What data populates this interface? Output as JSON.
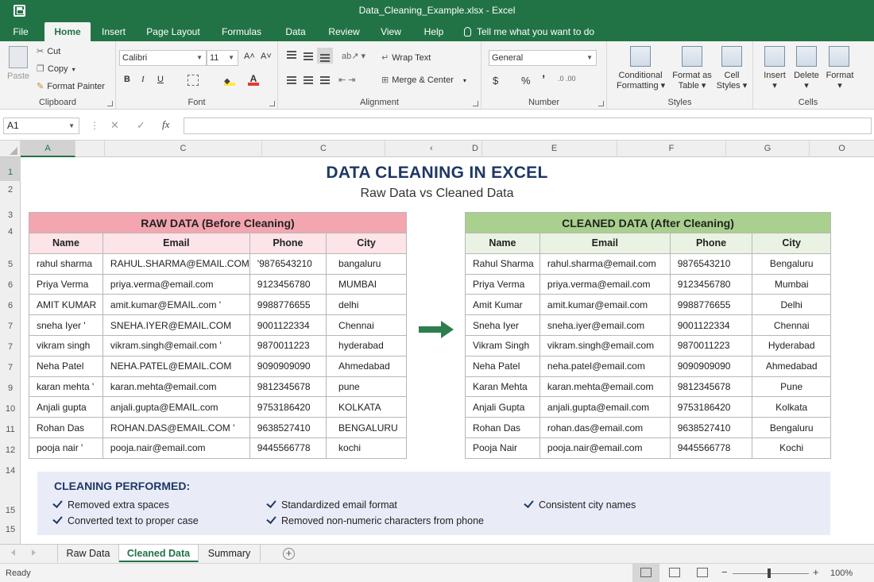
{
  "window": {
    "title": "Data_Cleaning_Example.xlsx  -  Excel"
  },
  "ribbon_tabs": [
    "File",
    "Home",
    "Insert",
    "Page Layout",
    "Formulas",
    "Data",
    "Review",
    "View",
    "Help"
  ],
  "tell_me": "Tell me what you want to do",
  "ribbon": {
    "clipboard": {
      "paste": "Paste",
      "cut": "Cut",
      "copy": "Copy",
      "format_painter": "Format Painter",
      "label": "Clipboard"
    },
    "font": {
      "name": "Calibri",
      "size": "11",
      "grow": "A˄",
      "shrink": "A˅",
      "bold": "B",
      "italic": "I",
      "underline": "U",
      "label": "Font"
    },
    "alignment": {
      "wrap_text": "Wrap Text",
      "merge_center": "Merge & Center",
      "label": "Alignment"
    },
    "number": {
      "format": "General",
      "currency": "$",
      "percent": "%",
      "comma": "ʼ",
      "label": "Number"
    },
    "styles": {
      "conditional_1": "Conditional",
      "conditional_2": "Formatting",
      "format_table_1": "Format as",
      "format_table_2": "Table",
      "cell_styles_1": "Cell",
      "cell_styles_2": "Styles",
      "label": "Styles"
    },
    "cells": {
      "insert": "Insert",
      "delete": "Delete",
      "format": "Format",
      "label": "Cells"
    }
  },
  "formula_bar": {
    "name_box": "A1",
    "cancel": "✕",
    "enter": "✓",
    "fx": "fx",
    "content": ""
  },
  "columns": [
    "A",
    "C",
    "C",
    "D",
    "E",
    "F",
    "G",
    "O"
  ],
  "rows": [
    "1",
    "2",
    "3",
    "4",
    "5",
    "6",
    "6",
    "7",
    "7",
    "7",
    "9",
    "10",
    "11",
    "12",
    "14",
    "15",
    "15"
  ],
  "sheet": {
    "title": "DATA CLEANING IN EXCEL",
    "subtitle": "Raw Data vs Cleaned Data",
    "raw": {
      "banner": "RAW DATA (Before Cleaning)",
      "headers": [
        "Name",
        "Email",
        "Phone",
        "City"
      ],
      "rows": [
        [
          "rahul sharma",
          "RAHUL.SHARMA@EMAIL.COM",
          "'9876543210",
          "bangaluru"
        ],
        [
          "Priya  Verma",
          "priya.verma@email.com",
          "9123456780",
          "MUMBAI"
        ],
        [
          "AMIT KUMAR",
          "amit.kumar@EMAIL.com '",
          "9988776655",
          "delhi"
        ],
        [
          "sneha Iyer '",
          "SNEHA.IYER@EMAIL.COM",
          "9001122334",
          "Chennai"
        ],
        [
          "vikram singh",
          "vikram.singh@email.com '",
          "9870011223",
          "hyderabad"
        ],
        [
          "Neha Patel",
          " NEHA.PATEL@EMAIL.COM",
          "9090909090",
          "Ahmedabad"
        ],
        [
          "karan mehta '",
          "karan.mehta@email.com",
          "9812345678",
          "pune"
        ],
        [
          "Anjali  gupta",
          "anjali.gupta@EMAIL.com",
          "9753186420",
          "KOLKATA"
        ],
        [
          "Rohan Das",
          " ROHAN.DAS@EMAIL.COM '",
          "9638527410",
          "BENGALURU"
        ],
        [
          "pooja nair '",
          "pooja.nair@email.com",
          "9445566778",
          "kochi"
        ]
      ]
    },
    "clean": {
      "banner": "CLEANED DATA (After Cleaning)",
      "headers": [
        "Name",
        "Email",
        "Phone",
        "City"
      ],
      "rows": [
        [
          "Rahul Sharma",
          "rahul.sharma@email.com",
          "9876543210",
          "Bengaluru"
        ],
        [
          "Priya Verma",
          "priya.verma@email.com",
          "9123456780",
          "Mumbai"
        ],
        [
          "Amit Kumar",
          "amit.kumar@email.com",
          "9988776655",
          "Delhi"
        ],
        [
          "Sneha Iyer",
          "sneha.iyer@email.com",
          "9001122334",
          "Chennai"
        ],
        [
          "Vikram Singh",
          "vikram.singh@email.com",
          "9870011223",
          "Hyderabad"
        ],
        [
          "Neha Patel",
          "neha.patel@email.com",
          "9090909090",
          "Ahmedabad"
        ],
        [
          "Karan Mehta",
          "karan.mehta@email.com",
          "9812345678",
          "Pune"
        ],
        [
          "Anjali Gupta",
          "anjali.gupta@email.com",
          "9753186420",
          "Kolkata"
        ],
        [
          "Rohan Das",
          "rohan.das@email.com",
          "9638527410",
          "Bengaluru"
        ],
        [
          "Pooja Nair",
          "pooja.nair@email.com",
          "9445566778",
          "Kochi"
        ]
      ]
    },
    "cleaning": {
      "title": "CLEANING PERFORMED:",
      "items": [
        "Removed extra spaces",
        "Converted text to proper case",
        "Standardized email format",
        "Removed non-numeric characters from phone",
        "Consistent city names"
      ]
    }
  },
  "sheet_tabs": [
    "Raw Data",
    "Cleaned Data",
    "Summary"
  ],
  "active_sheet": "Cleaned Data",
  "status": {
    "ready": "Ready",
    "zoom": "100%",
    "minus": "−",
    "plus": "+"
  },
  "colors": {
    "excel_green": "#217346",
    "raw_banner": "#f4a6b0",
    "clean_banner": "#a9d08e",
    "title_navy": "#1f3864",
    "arrow_green": "#2e7d4f"
  }
}
